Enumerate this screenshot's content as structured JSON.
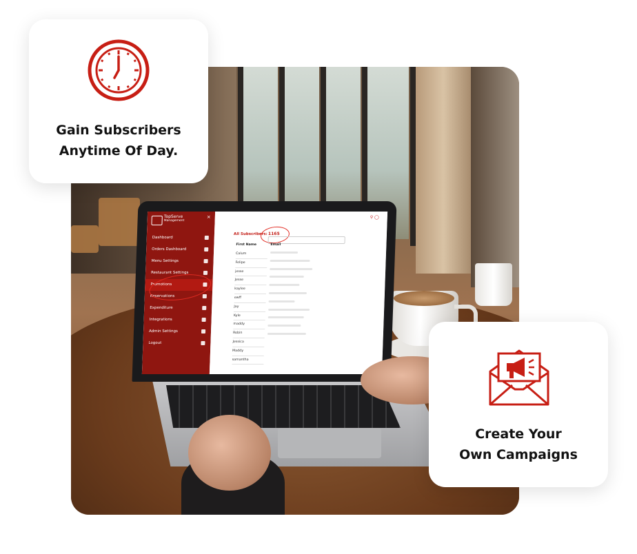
{
  "cards": {
    "subscribers": {
      "icon": "clock-icon",
      "line1": "Gain Subscribers",
      "line2": "Anytime Of Day."
    },
    "campaigns": {
      "icon": "megaphone-envelope-icon",
      "line1": "Create Your",
      "line2": "Own Campaigns"
    }
  },
  "colors": {
    "brand_red": "#c71e14",
    "sidebar_red": "#8f1610"
  },
  "app": {
    "brand_name": "TopServe",
    "brand_sub": "Management",
    "close": "×",
    "nav": [
      {
        "label": "Dashboard",
        "icon": "home-icon"
      },
      {
        "label": "Orders Dashboard",
        "icon": "monitor-icon"
      },
      {
        "label": "Menu Settings",
        "icon": "utensils-icon"
      },
      {
        "label": "Restaurant Settings",
        "icon": "building-icon"
      },
      {
        "label": "Promotions",
        "icon": "flag-icon",
        "active": true
      },
      {
        "label": "Reservations",
        "icon": "calendar-icon"
      },
      {
        "label": "Expenditure",
        "icon": "dollar-icon"
      },
      {
        "label": "Integrations",
        "icon": "plug-icon"
      },
      {
        "label": "Admin Settings",
        "icon": "gear-icon"
      },
      {
        "label": "Logout",
        "icon": "logout-icon"
      }
    ],
    "subscribers_label": "All Subscribers:",
    "subscribers_count": "1165",
    "columns": {
      "first_name": "First Name",
      "email": "Email"
    },
    "names": [
      "Calum",
      "Felipe",
      "jesse",
      "Jesse",
      "kaylee",
      "ewff",
      "Jay",
      "Kyle",
      "maddy",
      "Robin",
      "Jessica",
      "Maddy",
      "samantha"
    ]
  }
}
